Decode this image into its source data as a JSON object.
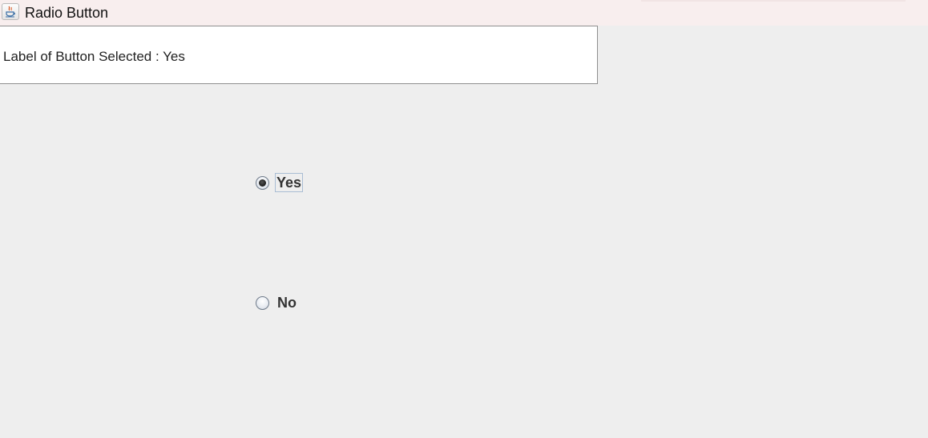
{
  "window": {
    "title": "Radio Button",
    "icon": "java-coffee-cup-icon"
  },
  "status": {
    "text": "Label of Button Selected : Yes"
  },
  "radios": [
    {
      "label": "Yes",
      "checked": true
    },
    {
      "label": "No",
      "checked": false
    }
  ],
  "colors": {
    "background": "#eeeeee",
    "titlebar": "#f8eeee",
    "panel": "#ffffff"
  }
}
